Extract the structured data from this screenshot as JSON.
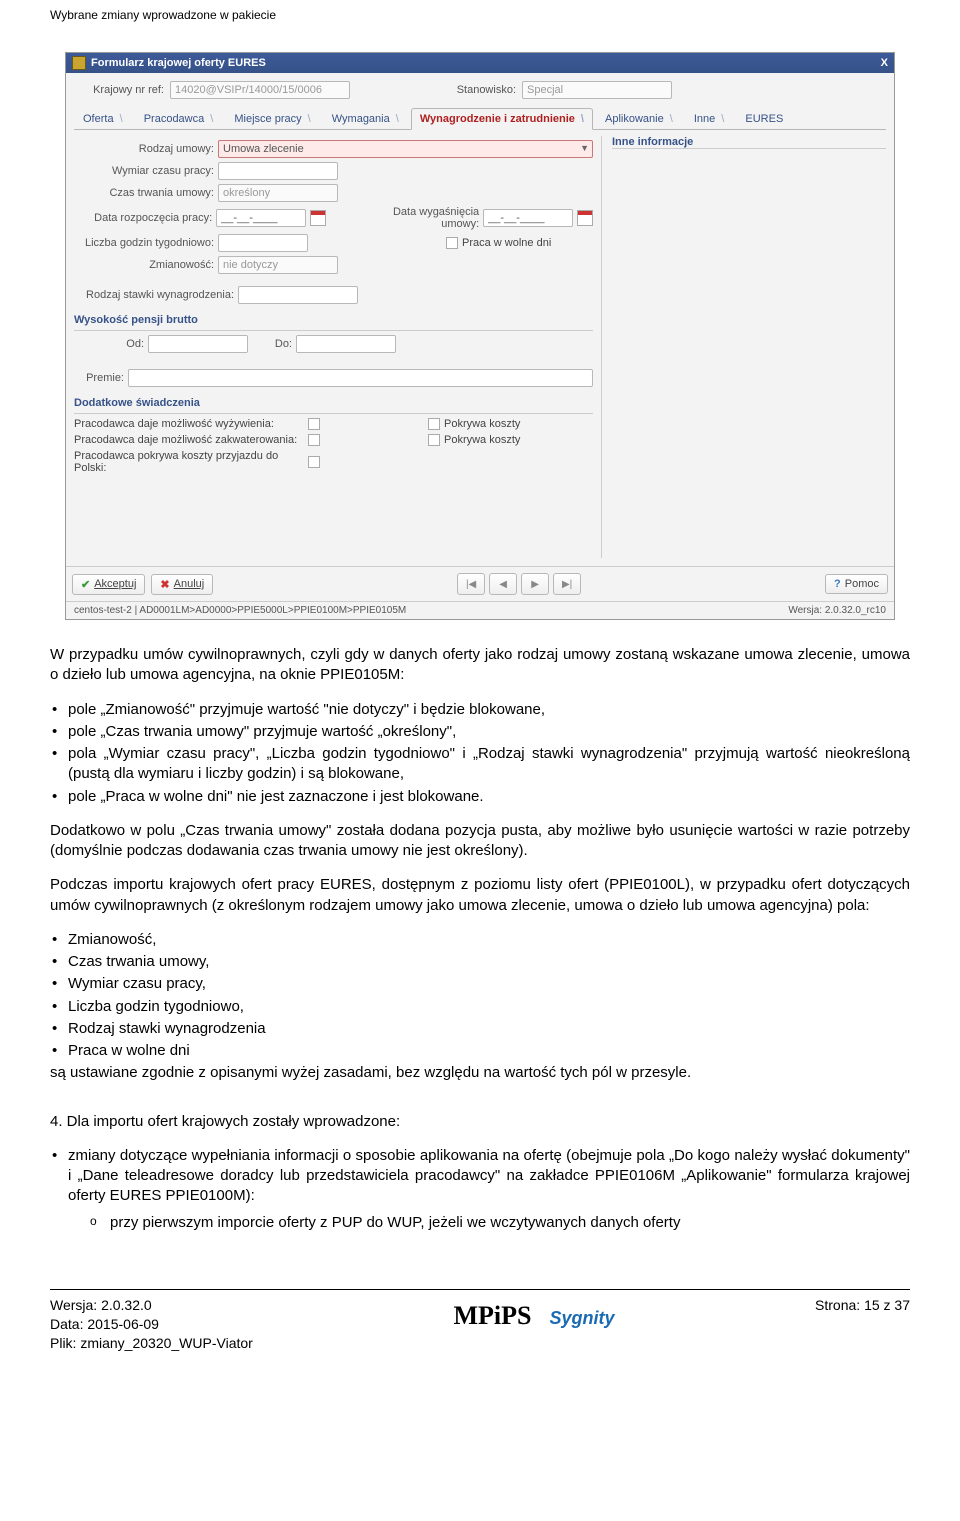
{
  "header": "Wybrane zmiany wprowadzone w pakiecie",
  "screenshot": {
    "title": "Formularz krajowej oferty EURES",
    "close_label": "X",
    "krajowy_label": "Krajowy nr ref:",
    "krajowy_value": "14020@VSIPr/14000/15/0006",
    "stanowisko_label": "Stanowisko:",
    "stanowisko_value": "Specjal",
    "tabs": [
      "Oferta",
      "Pracodawca",
      "Miejsce pracy",
      "Wymagania",
      "Wynagrodzenie i zatrudnienie",
      "Aplikowanie",
      "Inne",
      "EURES"
    ],
    "active_tab_index": 4,
    "right_panel_title": "Inne informacje",
    "fields": {
      "rodzaj_umowy_label": "Rodzaj umowy:",
      "rodzaj_umowy_value": "Umowa zlecenie",
      "wymiar_label": "Wymiar czasu pracy:",
      "czas_trwania_label": "Czas trwania umowy:",
      "czas_trwania_value": "określony",
      "data_rozp_label": "Data rozpoczęcia pracy:",
      "data_rozp_value": "__-__-____",
      "data_wyga_label": "Data wygaśnięcia umowy:",
      "data_wyga_value": "__-__-____",
      "liczba_godzin_label": "Liczba godzin tygodniowo:",
      "praca_wolne_label": "Praca w wolne dni",
      "zmianowosc_label": "Zmianowość:",
      "zmianowosc_value": "nie dotyczy",
      "rodzaj_stawki_label": "Rodzaj stawki wynagrodzenia:",
      "wysokosc_title": "Wysokość pensji brutto",
      "od_label": "Od:",
      "do_label": "Do:",
      "premie_label": "Premie:",
      "dodatkowe_title": "Dodatkowe świadczenia",
      "wyzywienie_label": "Pracodawca daje możliwość wyżywienia:",
      "zakwaterowanie_label": "Pracodawca daje możliwość zakwaterowania:",
      "przyjazd_label": "Pracodawca pokrywa koszty przyjazdu do Polski:",
      "pokrywa_label": "Pokrywa koszty"
    },
    "buttons": {
      "accept": "Akceptuj",
      "cancel": "Anuluj",
      "help": "Pomoc"
    },
    "status_left": "centos-test-2 | AD0001LM>AD0000>PPIE5000L>PPIE0100M>PPIE0105M",
    "status_right": "Wersja: 2.0.32.0_rc10"
  },
  "para1": "W przypadku umów cywilnoprawnych, czyli gdy w danych oferty jako rodzaj umowy zostaną wskazane umowa zlecenie, umowa o dzieło lub umowa agencyjna, na oknie PPIE0105M:",
  "list1": [
    "pole „Zmianowość\" przyjmuje wartość \"nie dotyczy\" i będzie blokowane,",
    "pole „Czas trwania umowy\" przyjmuje wartość „określony\",",
    "pola „Wymiar czasu pracy\", „Liczba godzin tygodniowo\" i „Rodzaj stawki wynagrodzenia\" przyjmują wartość nieokreśloną (pustą dla wymiaru i liczby godzin) i są blokowane,",
    "pole „Praca w wolne dni\" nie jest zaznaczone i jest blokowane."
  ],
  "para2": "Dodatkowo w polu „Czas trwania umowy\" została dodana pozycja pusta, aby możliwe było usunięcie wartości w razie potrzeby (domyślnie podczas dodawania czas trwania umowy nie jest określony).",
  "para3": "Podczas importu krajowych ofert pracy EURES, dostępnym z poziomu listy ofert (PPIE0100L), w przypadku ofert dotyczących umów cywilnoprawnych (z określonym rodzajem umowy jako umowa zlecenie, umowa o dzieło lub umowa agencyjna) pola:",
  "list2": [
    "Zmianowość,",
    "Czas trwania umowy,",
    "Wymiar czasu pracy,",
    "Liczba godzin tygodniowo,",
    "Rodzaj stawki wynagrodzenia",
    "Praca w wolne dni"
  ],
  "para4": "są ustawiane zgodnie z opisanymi wyżej zasadami, bez względu na wartość tych pól w przesyle.",
  "para5": "4. Dla importu ofert krajowych zostały wprowadzone:",
  "list3": [
    "zmiany dotyczące wypełniania informacji o sposobie aplikowania na ofertę (obejmuje pola „Do kogo należy wysłać dokumenty\" i „Dane teleadresowe doradcy lub przedstawiciela pracodawcy\" na zakładce PPIE0106M „Aplikowanie\" formularza krajowej oferty EURES PPIE0100M):"
  ],
  "sub_o_1": "przy pierwszym imporcie oferty z PUP do WUP, jeżeli we wczytywanych danych oferty",
  "footer": {
    "wersja": "Wersja: 2.0.32.0",
    "data": "Data: 2015-06-09",
    "plik": "Plik: zmiany_20320_WUP-Viator",
    "mpips": "MPiPS",
    "sygnity": "Sygnity",
    "strona": "Strona: 15 z 37"
  }
}
